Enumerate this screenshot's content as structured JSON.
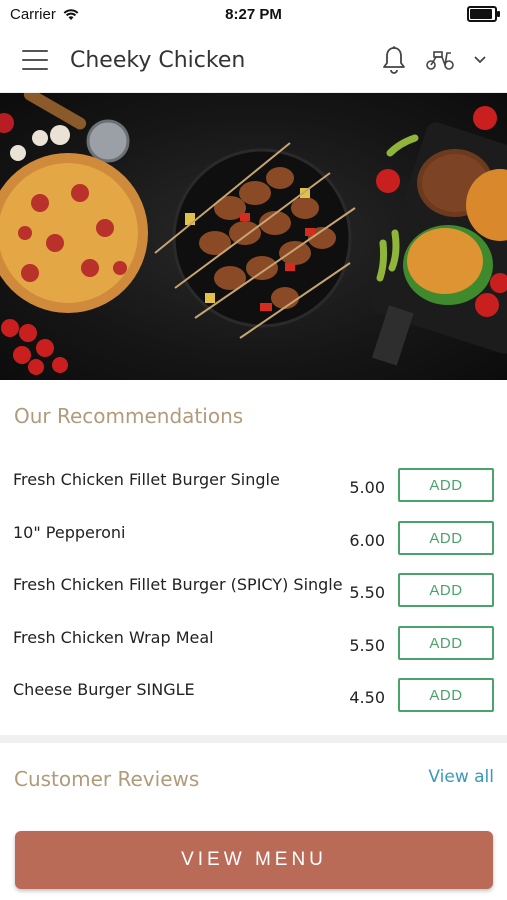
{
  "status_bar": {
    "carrier": "Carrier",
    "time": "8:27 PM"
  },
  "header": {
    "title": "Cheeky Chicken"
  },
  "recommendations": {
    "title": "Our Recommendations",
    "items": [
      {
        "name": "Fresh Chicken Fillet Burger Single",
        "price": "5.00",
        "button": "ADD"
      },
      {
        "name": "10\" Pepperoni",
        "price": "6.00",
        "button": "ADD"
      },
      {
        "name": "Fresh Chicken Fillet Burger (SPICY) Single",
        "price": "5.50",
        "button": "ADD"
      },
      {
        "name": "Fresh Chicken Wrap Meal",
        "price": "5.50",
        "button": "ADD"
      },
      {
        "name": "Cheese Burger SINGLE",
        "price": "4.50",
        "button": "ADD"
      }
    ]
  },
  "reviews": {
    "title": "Customer Reviews",
    "link": "View all"
  },
  "footer": {
    "button": "VIEW MENU"
  },
  "colors": {
    "accent_button": "#b96b58",
    "add_green": "#4aa36b",
    "section_title": "#b19b7a",
    "link_blue": "#3a98b8"
  },
  "icons": [
    "wifi-icon",
    "battery-icon",
    "hamburger-menu-icon",
    "bell-icon",
    "scooter-icon",
    "chevron-down-icon"
  ]
}
